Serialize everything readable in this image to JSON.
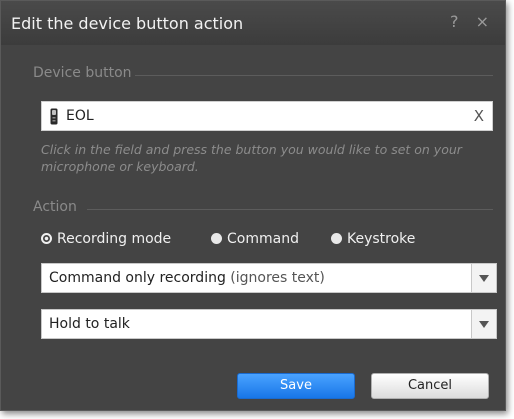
{
  "dialog": {
    "title": "Edit the device button action",
    "help_icon": "?",
    "close_icon": "×"
  },
  "device_section": {
    "label": "Device button",
    "field_value": "EOL",
    "clear_label": "X",
    "hint": "Click in the field and press the button you would like to set on your microphone or keyboard."
  },
  "action_section": {
    "label": "Action",
    "radios": [
      {
        "label": "Recording mode",
        "selected": true
      },
      {
        "label": "Command",
        "selected": false
      },
      {
        "label": "Keystroke",
        "selected": false
      }
    ],
    "mode_select": {
      "value": "Command only recording",
      "note": "(ignores text)"
    },
    "trigger_select": {
      "value": "Hold to talk"
    }
  },
  "buttons": {
    "save": "Save",
    "cancel": "Cancel"
  },
  "colors": {
    "accent": "#1876e8",
    "dialog_bg": "#444444"
  }
}
